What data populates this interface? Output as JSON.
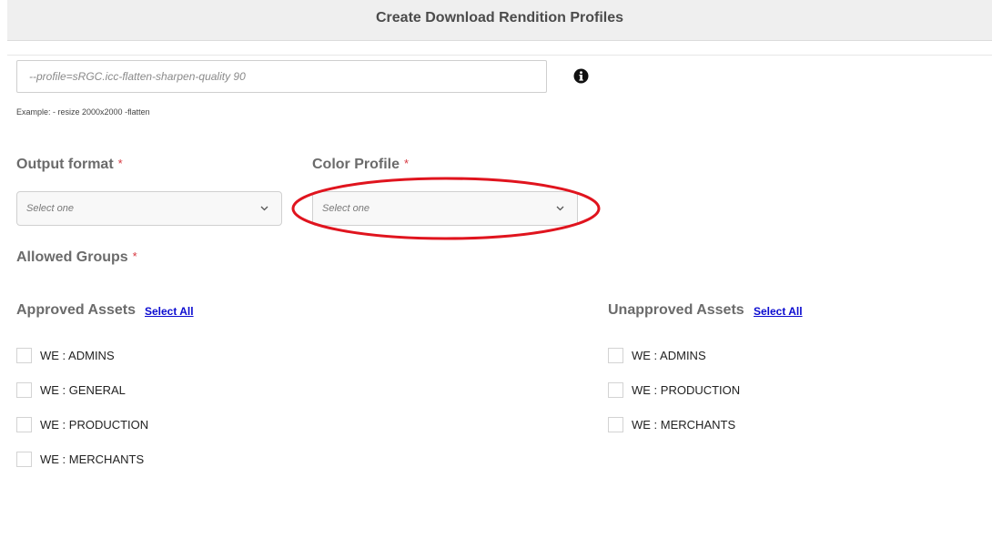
{
  "header": {
    "title": "Create Download Rendition Profiles"
  },
  "command": {
    "placeholder": "--profile=sRGC.icc-flatten-sharpen-quality 90",
    "info_icon": "info-icon",
    "example": "Example: - resize 2000x2000 -flatten"
  },
  "output_format": {
    "label": "Output format",
    "required_mark": "*",
    "selected": "Select one"
  },
  "color_profile": {
    "label": "Color Profile",
    "required_mark": "*",
    "selected": "Select one",
    "highlight_color": "#e0141e"
  },
  "allowed_groups": {
    "label": "Allowed Groups",
    "required_mark": "*"
  },
  "approved": {
    "title": "Approved Assets",
    "select_all": "Select All",
    "groups": [
      "WE : ADMINS",
      "WE : GENERAL",
      "WE : PRODUCTION",
      "WE : MERCHANTS"
    ]
  },
  "unapproved": {
    "title": "Unapproved Assets",
    "select_all": "Select All",
    "groups": [
      "WE : ADMINS",
      "WE : PRODUCTION",
      "WE : MERCHANTS"
    ]
  },
  "colors": {
    "required": "#d7373f",
    "link": "#0b0bd0",
    "label": "#6b6b6b"
  }
}
